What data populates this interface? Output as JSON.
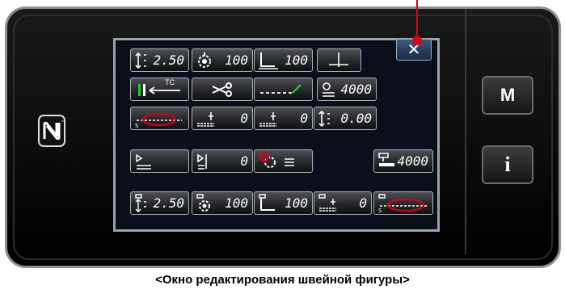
{
  "caption": "<Окно редактирования швейной фигуры>",
  "accent_color": "#d8001c",
  "side_buttons": {
    "menu_label": "M",
    "info_label": "i"
  },
  "close_button": {
    "label": "✕"
  },
  "rows": [
    [
      {
        "icon": "stitch-length-icon",
        "value": "2.50"
      },
      {
        "icon": "thread-tension-icon",
        "value": "100"
      },
      {
        "icon": "presser-foot-pressure-icon",
        "value": "100"
      },
      {
        "icon": "needle-position-icon",
        "value": ""
      }
    ],
    [
      {
        "icon": "thread-clamp-tc-icon",
        "value": "",
        "label": "TC"
      },
      {
        "icon": "thread-trimmer-icon",
        "value": ""
      },
      {
        "icon": "reverse-stitch-icon",
        "value": ""
      },
      {
        "icon": "max-speed-icon",
        "value": "4000"
      }
    ],
    [
      {
        "icon": "condensation-stitch-icon",
        "value": ""
      },
      {
        "icon": "feed-amount-start-icon",
        "value": "0"
      },
      {
        "icon": "feed-amount-end-icon",
        "value": "0"
      },
      {
        "icon": "micro-lift-icon",
        "value": "0.00"
      }
    ],
    [
      {
        "icon": "sewing-speed-icon",
        "value": ""
      },
      {
        "icon": "speed-correction-icon",
        "value": "0"
      },
      {
        "icon": "tension-release-icon",
        "value": ""
      },
      {
        "icon": "max-speed-custom-icon",
        "value": "4000"
      }
    ],
    [
      {
        "icon": "custom-stitch-length-icon",
        "value": "2.50"
      },
      {
        "icon": "custom-thread-tension-icon",
        "value": "100"
      },
      {
        "icon": "custom-presser-foot-icon",
        "value": "100"
      },
      {
        "icon": "custom-feed-amount-icon",
        "value": "0"
      },
      {
        "icon": "custom-condensation-icon",
        "value": ""
      }
    ]
  ]
}
